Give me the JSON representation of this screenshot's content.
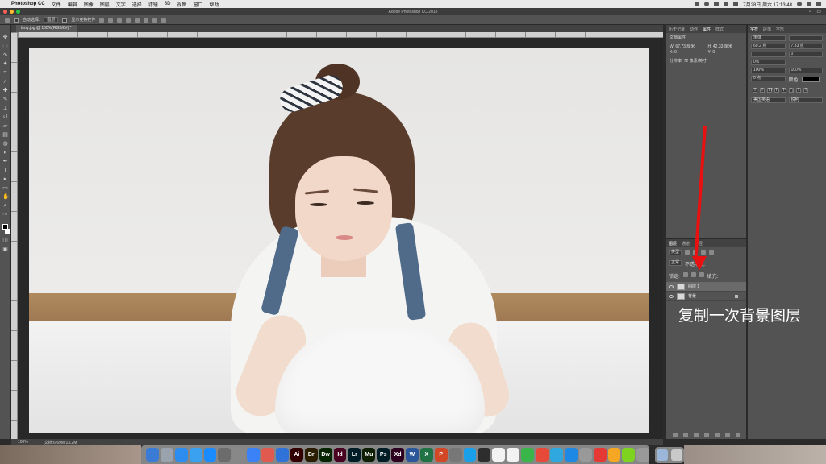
{
  "menubar": {
    "app_name": "Photoshop CC",
    "items": [
      "文件",
      "编辑",
      "图像",
      "图层",
      "文字",
      "选择",
      "滤镜",
      "3D",
      "视图",
      "窗口",
      "帮助"
    ],
    "datetime": "7月28日 周六 17:13:48"
  },
  "window": {
    "title": "Adobe Photoshop CC 2018"
  },
  "options": {
    "auto_select": "自动选择:",
    "target": "图层",
    "show_transform": "显示变换控件"
  },
  "document": {
    "tab": "timg.jpg @ 100%(RGB/8#) *"
  },
  "status": {
    "zoom": "100%",
    "doc_size": "文档:6.69M/13.2M"
  },
  "properties_panel": {
    "tabs": [
      "历史记录",
      "动作",
      "属性",
      "样式"
    ],
    "active_tab": "属性",
    "section": "文档属性",
    "w": "W: 67.73 厘米",
    "h": "H: 42.33 厘米",
    "x": "X: 0",
    "y": "Y: 0",
    "resolution": "分辨率: 72 像素/英寸"
  },
  "character_panel": {
    "tabs": [
      "字符",
      "段落",
      "字形"
    ],
    "font": "宋体",
    "size": "60.2 点",
    "leading": "7.33 点",
    "tracking": "0",
    "kerning": "0%",
    "vscale": "100%",
    "hscale": "100%",
    "baseline": "0 点",
    "color_label": "颜色:",
    "language": "美国英语",
    "antialias": "锐利",
    "style_buttons": [
      "T",
      "T",
      "TT",
      "Tt",
      "T¹",
      "T₁",
      "T",
      "T"
    ]
  },
  "layers_panel": {
    "tabs": [
      "图层",
      "通道",
      "路径"
    ],
    "kind": "类型",
    "blend": "正常",
    "opacity_label": "不透明度:",
    "lock_label": "锁定:",
    "fill_label": "填充:",
    "layers": [
      {
        "name": "图层 1"
      },
      {
        "name": "背景"
      }
    ]
  },
  "annotation": {
    "text": "复制一次背景图层",
    "color": "#e81010"
  },
  "dock": {
    "apps": [
      {
        "label": "",
        "color": "#3a7bd5"
      },
      {
        "label": "",
        "color": "#9aa3ad"
      },
      {
        "label": "",
        "color": "#2d8cf0"
      },
      {
        "label": "",
        "color": "#3aa0f0"
      },
      {
        "label": "",
        "color": "#1a8cff"
      },
      {
        "label": "",
        "color": "#6c6c6c"
      },
      {
        "label": "",
        "color": "#888"
      },
      {
        "label": "",
        "color": "#3b82f6"
      },
      {
        "label": "",
        "color": "#e05a4f"
      },
      {
        "label": "",
        "color": "#2f73d8"
      },
      {
        "label": "Ai",
        "color": "#330000"
      },
      {
        "label": "Br",
        "color": "#2b1e00"
      },
      {
        "label": "Dw",
        "color": "#072401"
      },
      {
        "label": "Id",
        "color": "#49021f"
      },
      {
        "label": "Lr",
        "color": "#001c26"
      },
      {
        "label": "Mu",
        "color": "#0f1f05"
      },
      {
        "label": "Ps",
        "color": "#001d26"
      },
      {
        "label": "Xd",
        "color": "#2e001f"
      },
      {
        "label": "W",
        "color": "#2b579a"
      },
      {
        "label": "X",
        "color": "#217346"
      },
      {
        "label": "P",
        "color": "#d24726"
      },
      {
        "label": "",
        "color": "#777"
      },
      {
        "label": "",
        "color": "#1aa0e8"
      },
      {
        "label": "",
        "color": "#2d2d2d"
      },
      {
        "label": "",
        "color": "#f2f2f2"
      },
      {
        "label": "",
        "color": "#f2f2f2"
      },
      {
        "label": "",
        "color": "#3ab54a"
      },
      {
        "label": "",
        "color": "#e84a3a"
      },
      {
        "label": "",
        "color": "#2fa8e0"
      },
      {
        "label": "",
        "color": "#1e88e5"
      },
      {
        "label": "",
        "color": "#999"
      },
      {
        "label": "",
        "color": "#e53935"
      },
      {
        "label": "",
        "color": "#f5a623"
      },
      {
        "label": "",
        "color": "#7ed321"
      },
      {
        "label": "",
        "color": "#999"
      }
    ]
  }
}
